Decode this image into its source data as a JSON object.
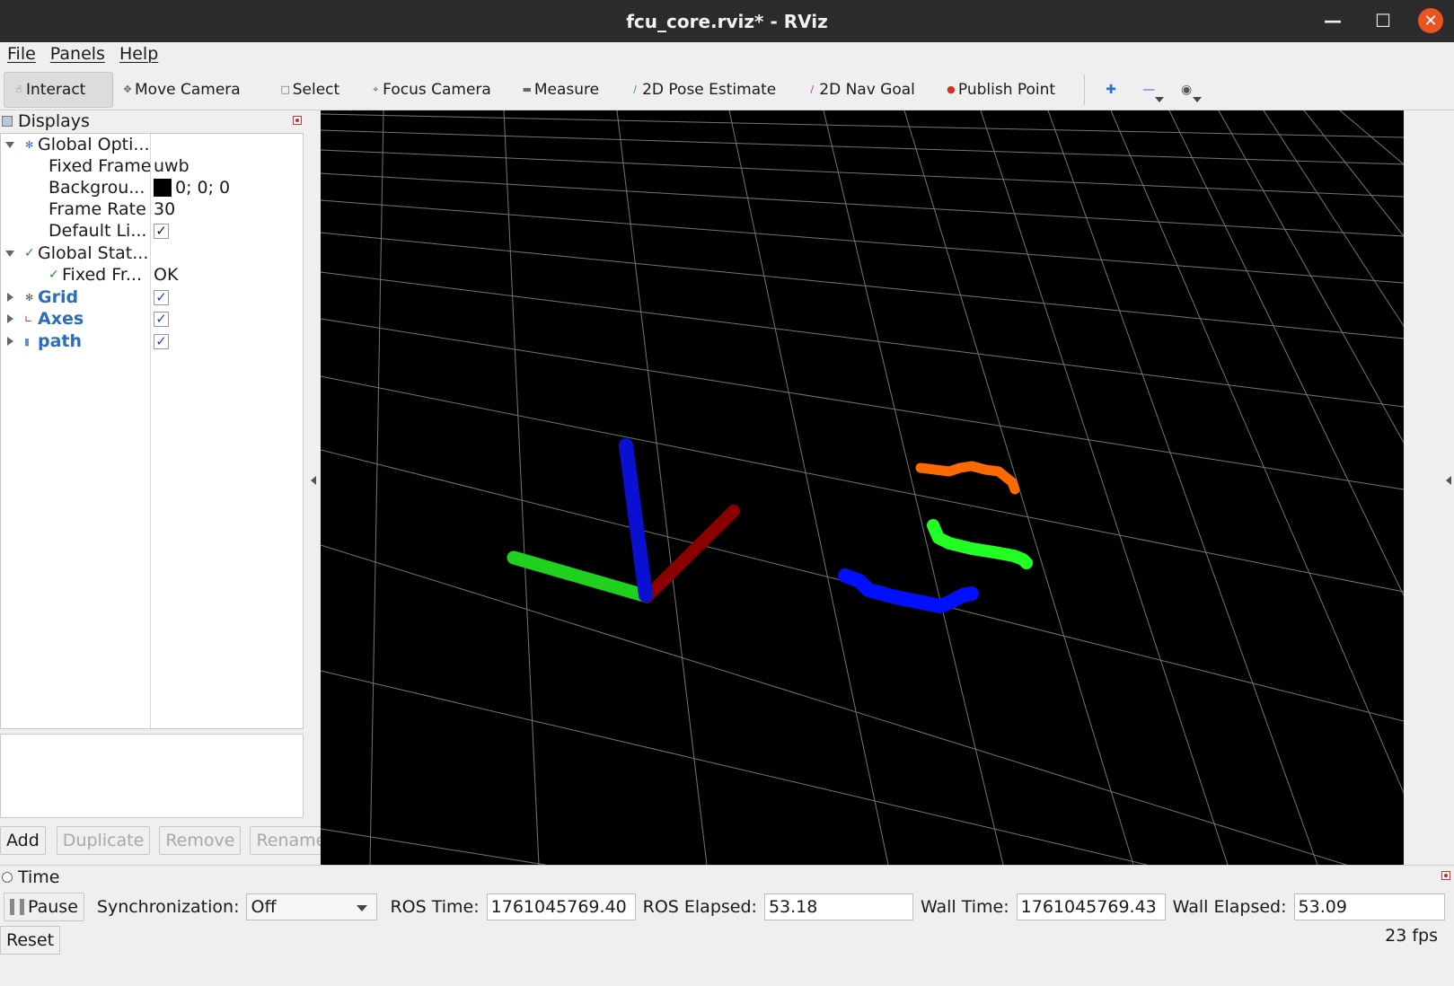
{
  "window": {
    "title": "fcu_core.rviz* - RViz"
  },
  "menu": [
    "File",
    "Panels",
    "Help"
  ],
  "toolbar": {
    "tools": [
      {
        "label": "Interact",
        "icon": "cursor-icon",
        "active": true
      },
      {
        "label": "Move Camera",
        "icon": "move-camera-icon"
      },
      {
        "label": "Select",
        "icon": "select-icon"
      },
      {
        "label": "Focus Camera",
        "icon": "focus-camera-icon"
      },
      {
        "label": "Measure",
        "icon": "measure-icon"
      },
      {
        "label": "2D Pose Estimate",
        "icon": "pose-estimate-icon"
      },
      {
        "label": "2D Nav Goal",
        "icon": "nav-goal-icon"
      },
      {
        "label": "Publish Point",
        "icon": "publish-point-icon"
      }
    ]
  },
  "displays": {
    "title": "Displays",
    "global_options": {
      "label": "Global Opti...",
      "fixed_frame_label": "Fixed Frame",
      "fixed_frame_value": "uwb",
      "background_label": "Backgrou...",
      "background_value": "0; 0; 0",
      "frame_rate_label": "Frame Rate",
      "frame_rate_value": "30",
      "default_light_label": "Default Li...",
      "default_light_checked": true
    },
    "global_status": {
      "label": "Global Stat...",
      "fixed_frame_label": "Fixed Fr...",
      "fixed_frame_value": "OK"
    },
    "items": [
      {
        "label": "Grid",
        "checked": true,
        "icon": "grid-icon"
      },
      {
        "label": "Axes",
        "checked": true,
        "icon": "axes-icon"
      },
      {
        "label": "path",
        "checked": true,
        "icon": "folder-icon"
      }
    ],
    "buttons": {
      "add": "Add",
      "duplicate": "Duplicate",
      "remove": "Remove",
      "rename": "Rename"
    }
  },
  "scene": {
    "background": "#000000",
    "grid_color": "#8a8a8a",
    "axis_colors": {
      "x": "#c00000",
      "y": "#00d000",
      "z": "#0000e0"
    },
    "path_colors": [
      "#ff6a00",
      "#22ff22",
      "#0010ff"
    ]
  },
  "time": {
    "title": "Time",
    "pause_label": "Pause",
    "sync_label": "Synchronization:",
    "sync_value": "Off",
    "ros_time_label": "ROS Time:",
    "ros_time_value": "1761045769.40",
    "ros_elapsed_label": "ROS Elapsed:",
    "ros_elapsed_value": "53.18",
    "wall_time_label": "Wall Time:",
    "wall_time_value": "1761045769.43",
    "wall_elapsed_label": "Wall Elapsed:",
    "wall_elapsed_value": "53.09",
    "reset_label": "Reset",
    "fps": "23 fps"
  }
}
